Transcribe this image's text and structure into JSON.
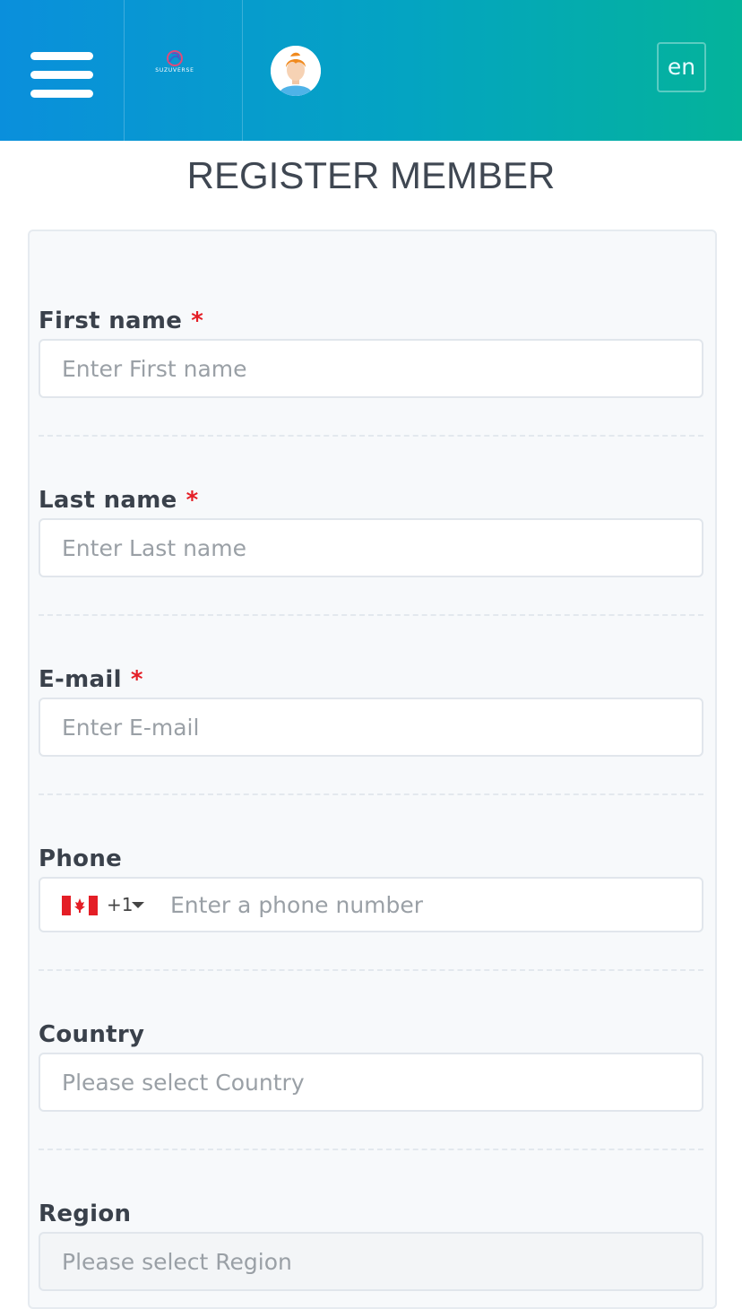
{
  "header": {
    "logo_text": "SUZUVERSE",
    "lang_label": "en"
  },
  "page": {
    "title": "REGISTER MEMBER"
  },
  "form": {
    "first_name": {
      "label": "First name",
      "required_mark": "*",
      "placeholder": "Enter First name",
      "value": ""
    },
    "last_name": {
      "label": "Last name",
      "required_mark": "*",
      "placeholder": "Enter Last name",
      "value": ""
    },
    "email": {
      "label": "E-mail",
      "required_mark": "*",
      "placeholder": "Enter E-mail",
      "value": ""
    },
    "phone": {
      "label": "Phone",
      "country_flag_icon": "canada-flag-icon",
      "dial_code": "+1",
      "placeholder": "Enter a phone number",
      "value": ""
    },
    "country": {
      "label": "Country",
      "placeholder": "Please select Country",
      "value": ""
    },
    "region": {
      "label": "Region",
      "placeholder": "Please select Region",
      "value": ""
    }
  },
  "colors": {
    "header_gradient_start": "#0a8fdc",
    "header_gradient_end": "#04b39a",
    "required": "#e41e26",
    "label": "#3a414b"
  }
}
